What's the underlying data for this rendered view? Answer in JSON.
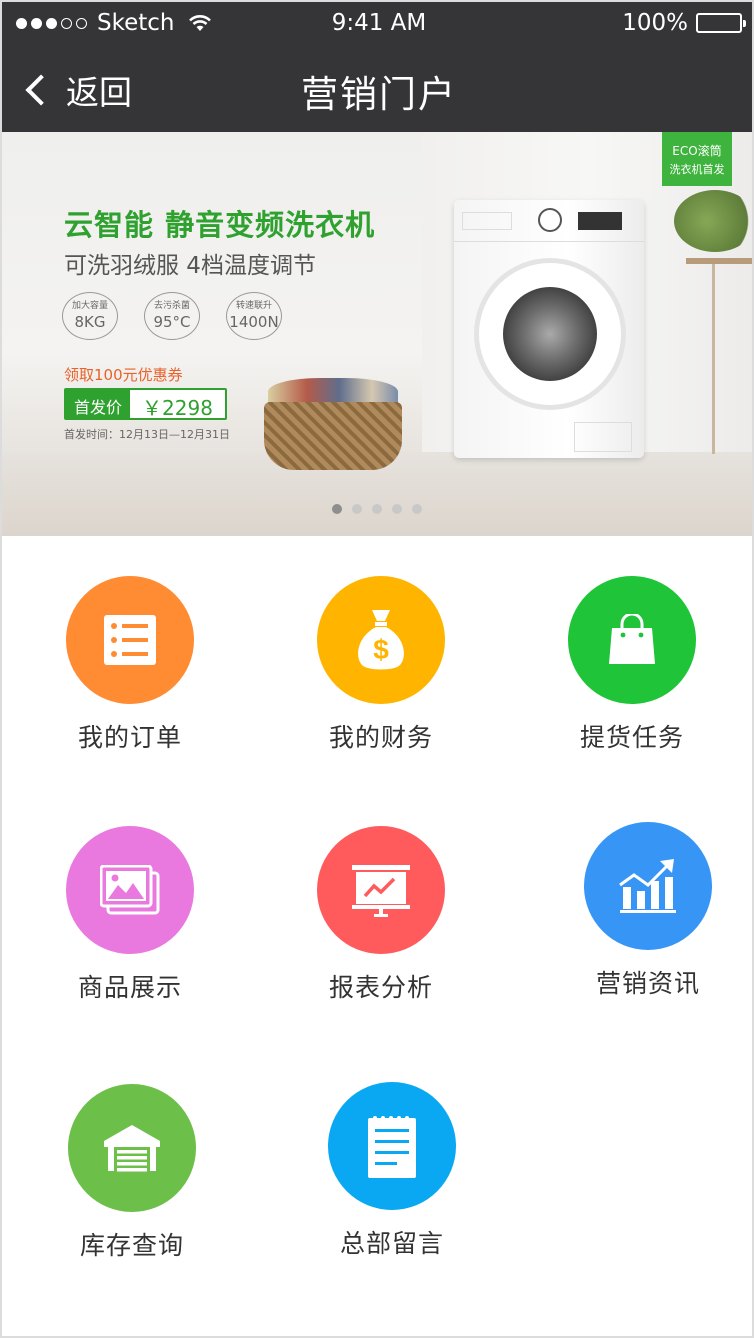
{
  "status_bar": {
    "carrier": "Sketch",
    "time": "9:41 AM",
    "battery": "100%"
  },
  "nav": {
    "back_label": "返回",
    "title": "营销门户"
  },
  "banner": {
    "headline": "云智能 静音变频洗衣机",
    "subheadline": "可洗羽绒服 4档温度调节",
    "specs": [
      {
        "label": "加大容量",
        "value": "8KG"
      },
      {
        "label": "去污杀菌",
        "value": "95°C"
      },
      {
        "label": "转速联升",
        "value": "1400N"
      }
    ],
    "coupon": "领取100元优惠券",
    "price_tag": "首发价",
    "price": "￥2298",
    "launch_date": "首发时间：12月13日—12月31日",
    "badge_line1": "ECO滚筒",
    "badge_line2": "洗衣机首发",
    "carousel": {
      "count": 5,
      "active": 1
    }
  },
  "colors": {
    "nav_bg": "#353538",
    "orders": "#ff8c33",
    "finance": "#ffb400",
    "pickup": "#1fc439",
    "products": "#e979df",
    "reports": "#ff5a5c",
    "news": "#3795f5",
    "inventory": "#6cc04a",
    "messages": "#0aa8f2"
  },
  "menu": [
    {
      "label": "我的订单",
      "icon": "order-list-icon",
      "color": "orders"
    },
    {
      "label": "我的财务",
      "icon": "money-bag-icon",
      "color": "finance"
    },
    {
      "label": "提货任务",
      "icon": "shopping-bag-icon",
      "color": "pickup"
    },
    {
      "label": "商品展示",
      "icon": "gallery-icon",
      "color": "products"
    },
    {
      "label": "报表分析",
      "icon": "presentation-chart-icon",
      "color": "reports"
    },
    {
      "label": "营销资讯",
      "icon": "growth-chart-icon",
      "color": "news"
    },
    {
      "label": "库存查询",
      "icon": "warehouse-icon",
      "color": "inventory"
    },
    {
      "label": "总部留言",
      "icon": "notepad-icon",
      "color": "messages"
    }
  ]
}
